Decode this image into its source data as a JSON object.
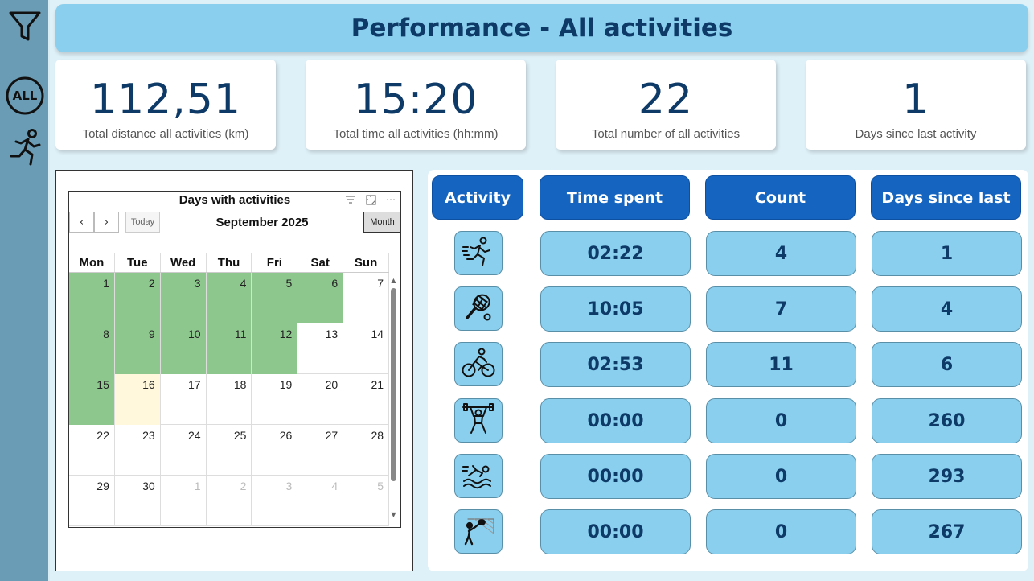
{
  "header": {
    "title": "Performance - All activities"
  },
  "sidebar": {
    "items": [
      {
        "icon": "filter-icon"
      },
      {
        "icon": "all-icon",
        "label": "ALL"
      },
      {
        "icon": "runner-icon"
      }
    ]
  },
  "kpis": [
    {
      "value": "112,51",
      "label": "Total distance all activities (km)"
    },
    {
      "value": "15:20",
      "label": "Total time all activities (hh:mm)"
    },
    {
      "value": "22",
      "label": "Total number of all activities"
    },
    {
      "value": "1",
      "label": "Days since last activity"
    }
  ],
  "calendar": {
    "title": "Days with activities",
    "month": "September 2025",
    "today_label": "Today",
    "view_label": "Month",
    "prev_label": "‹",
    "next_label": "›",
    "weekdays": [
      "Mon",
      "Tue",
      "Wed",
      "Thu",
      "Fri",
      "Sat",
      "Sun"
    ],
    "weeks": [
      [
        "1",
        "2",
        "3",
        "4",
        "5",
        "6",
        "7"
      ],
      [
        "8",
        "9",
        "10",
        "11",
        "12",
        "13",
        "14"
      ],
      [
        "15",
        "16",
        "17",
        "18",
        "19",
        "20",
        "21"
      ],
      [
        "22",
        "23",
        "24",
        "25",
        "26",
        "27",
        "28"
      ],
      [
        "29",
        "30",
        "1",
        "2",
        "3",
        "4",
        "5"
      ]
    ],
    "active_days": [
      "1",
      "2",
      "3",
      "4",
      "5",
      "6",
      "8",
      "9",
      "10",
      "11",
      "12",
      "15"
    ],
    "today_day": "16",
    "colors": {
      "active": "#8ec78e",
      "today": "#fff8dc"
    }
  },
  "table": {
    "headers": {
      "activity": "Activity",
      "time": "Time spent",
      "count": "Count",
      "days": "Days since last"
    },
    "rows": [
      {
        "icon": "running-icon",
        "time": "02:22",
        "count": "4",
        "days": "1"
      },
      {
        "icon": "tennis-icon",
        "time": "10:05",
        "count": "7",
        "days": "4"
      },
      {
        "icon": "cycling-icon",
        "time": "02:53",
        "count": "11",
        "days": "6"
      },
      {
        "icon": "weightlifting-icon",
        "time": "00:00",
        "count": "0",
        "days": "260"
      },
      {
        "icon": "swimming-icon",
        "time": "00:00",
        "count": "0",
        "days": "293"
      },
      {
        "icon": "padel-icon",
        "time": "00:00",
        "count": "0",
        "days": "267"
      }
    ]
  },
  "colors": {
    "header_bg": "#8acfee",
    "title": "#0e3a68",
    "table_header": "#1565c0",
    "cell_bg": "#8acfee",
    "sidebar": "#6a9db5"
  }
}
